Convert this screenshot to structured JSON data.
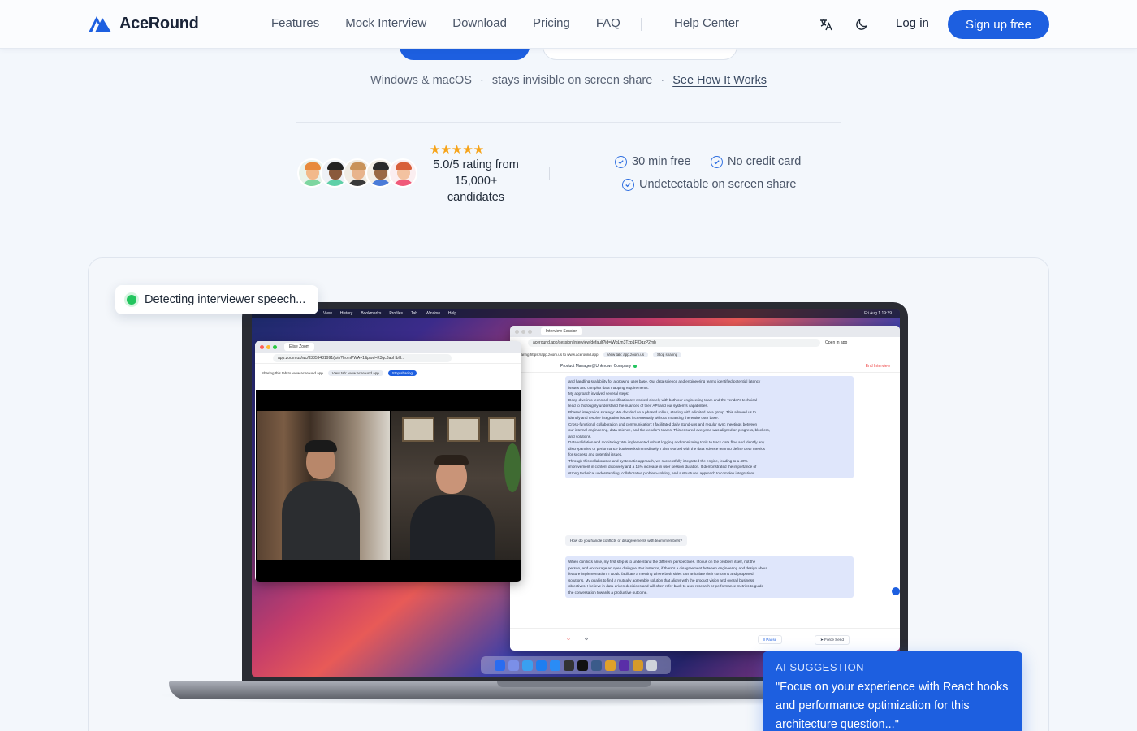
{
  "brand": {
    "name": "AceRound",
    "logo_icon": "mountain-logo-icon",
    "accent": "#1d5fe0"
  },
  "nav": {
    "links": [
      "Features",
      "Mock Interview",
      "Download",
      "Pricing",
      "FAQ"
    ],
    "help": "Help Center",
    "translate_icon": "translate-icon",
    "theme_icon": "moon-icon",
    "login": "Log in",
    "signup": "Sign up free"
  },
  "hero": {
    "platforms": "Windows & macOS",
    "separator": "·",
    "invisible": "stays invisible on screen share",
    "see_how": "See How It Works"
  },
  "social_proof": {
    "stars": "★★★★★",
    "rating": "5.0/5 rating from 15,000+ candidates",
    "features": [
      "30 min free",
      "No credit card",
      "Undetectable on screen share"
    ]
  },
  "showcase": {
    "toast": "Detecting interviewer speech...",
    "ai_suggestion_title": "AI SUGGESTION",
    "ai_suggestion_body": "\"Focus on your experience with React hooks and performance optimization for this architecture question...\""
  },
  "screen": {
    "menubar": [
      "View",
      "History",
      "Bookmarks",
      "Profiles",
      "Tab",
      "Window",
      "Help"
    ],
    "clock": "Fri Aug 1 19:29",
    "zoom_tab": "Elise Zoom",
    "zoom_url": "app.zoom.us/wc/83359481991/join?fromPWA=1&pwd=K3gc8aoHbH...",
    "zoom_share_text": "Sharing this tab to www.aceround.app",
    "zoom_view_tab": "View tab: www.aceround.app",
    "zoom_stop": "Stop sharing",
    "session_tab": "Interview Session",
    "session_url": "aceround.app/session/interview/default?id=iWqLm3Tzp1FlOqzP2mb",
    "session_open_app": "Open in app",
    "session_share_text": "Sharing https://app.zoom.us to www.aceround.app",
    "session_view_tab": "View tab: app.zoom.us",
    "session_stop": "Stop sharing",
    "company": "Product Manager@Unknown Company",
    "end_interview": "End Interview",
    "answer1": [
      "and handling scalability for a growing user base. Our data science and engineering teams identified potential latency",
      "issues and complex data mapping requirements.",
      "My approach involved several steps:",
      "Deep-dive into technical specifications: I worked closely with both our engineering team and the vendor's technical",
      "lead to thoroughly understand the nuances of their API and our system's capabilities.",
      "Phased integration strategy: We decided on a phased rollout, starting with a limited beta group. This allowed us to",
      "identify and resolve integration issues incrementally without impacting the entire user base.",
      "Cross-functional collaboration and communication: I facilitated daily stand-ups and regular sync meetings between",
      "our internal engineering, data science, and the vendor's teams. This ensured everyone was aligned on progress, blockers,",
      "and solutions.",
      "Data validation and monitoring: We implemented robust logging and monitoring tools to track data flow and identify any",
      "discrepancies or performance bottlenecks immediately. I also worked with the data science team to define clear metrics",
      "for success and potential issues.",
      "Through this collaborative and systematic approach, we successfully integrated the engine, leading to a 40%",
      "improvement in content discovery and a 15% increase in user session duration. It demonstrated the importance of",
      "strong technical understanding, collaborative problem-solving, and a structured approach to complex integrations."
    ],
    "question": "How do you handle conflicts or disagreements with team members?",
    "answer2": [
      "When conflicts arise, my first step is to understand the different perspectives. I focus on the problem itself, not the",
      "person, and encourage an open dialogue. For instance, if there's a disagreement between engineering and design about",
      "feature implementation, I would facilitate a meeting where both sides can articulate their concerns and proposed",
      "solutions. My goal is to find a mutually agreeable solution that aligns with the product vision and overall business",
      "objectives. I believe in data-driven decisions and will often refer back to user research or performance metrics to guide",
      "the conversation towards a productive outcome."
    ],
    "pause": "Pause",
    "force_send": "Force Send"
  }
}
